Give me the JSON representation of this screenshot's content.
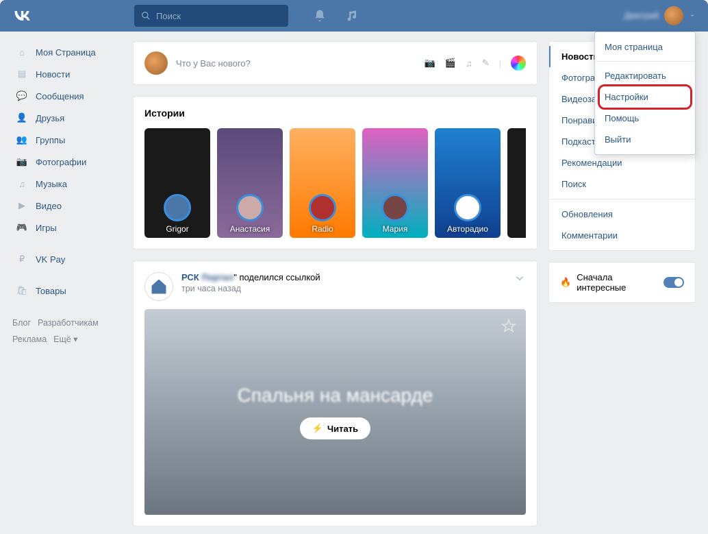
{
  "header": {
    "search_placeholder": "Поиск",
    "user_name": "Дмитрий"
  },
  "leftnav": {
    "items": [
      {
        "icon": "home",
        "label": "Моя Страница"
      },
      {
        "icon": "news",
        "label": "Новости"
      },
      {
        "icon": "msg",
        "label": "Сообщения"
      },
      {
        "icon": "friends",
        "label": "Друзья"
      },
      {
        "icon": "groups",
        "label": "Группы"
      },
      {
        "icon": "photo",
        "label": "Фотографии"
      },
      {
        "icon": "music",
        "label": "Музыка"
      },
      {
        "icon": "video",
        "label": "Видео"
      },
      {
        "icon": "games",
        "label": "Игры"
      }
    ],
    "sep_items": [
      {
        "icon": "pay",
        "label": "VK Pay"
      }
    ],
    "sep2_items": [
      {
        "icon": "market",
        "label": "Товары"
      }
    ],
    "footer": [
      "Блог",
      "Разработчикам",
      "Реклама",
      "Ещё ▾"
    ]
  },
  "compose": {
    "prompt": "Что у Вас нового?"
  },
  "stories": {
    "title": "Истории",
    "items": [
      {
        "label": "Grigor",
        "bg": "#1a1a1a"
      },
      {
        "label": "Анастасия",
        "bg": "linear-gradient(#5a4a7a,#8a6a9a)"
      },
      {
        "label": "Radio",
        "bg": "linear-gradient(#ffb060,#ff7a00)"
      },
      {
        "label": "Мария",
        "bg": "linear-gradient(#e060c0,#00b0c0)"
      },
      {
        "label": "Авторадио",
        "bg": "linear-gradient(#2080d0,#104090)"
      },
      {
        "label": "",
        "bg": "#1a1a1a"
      }
    ]
  },
  "post": {
    "author_prefix": "РСК",
    "author_blur": "Портал",
    "shared": "\" поделился ссылкой",
    "time": "три часа назад",
    "overlay_title": "Спальня на мансарде",
    "read_label": "Читать"
  },
  "rightnav": {
    "items": [
      {
        "label": "Новости",
        "active": true
      },
      {
        "label": "Фотографии"
      },
      {
        "label": "Видеозаписи"
      },
      {
        "label": "Понравилось"
      },
      {
        "label": "Подкасты"
      },
      {
        "label": "Рекомендации"
      },
      {
        "label": "Поиск"
      }
    ],
    "items2": [
      {
        "label": "Обновления"
      },
      {
        "label": "Комментарии"
      }
    ]
  },
  "interesting": {
    "label": "Сначала интересные"
  },
  "dropdown": {
    "items": [
      {
        "label": "Моя страница"
      },
      {
        "sep": true
      },
      {
        "label": "Редактировать"
      },
      {
        "label": "Настройки",
        "highlight": true
      },
      {
        "label": "Помощь"
      },
      {
        "label": "Выйти"
      }
    ]
  }
}
